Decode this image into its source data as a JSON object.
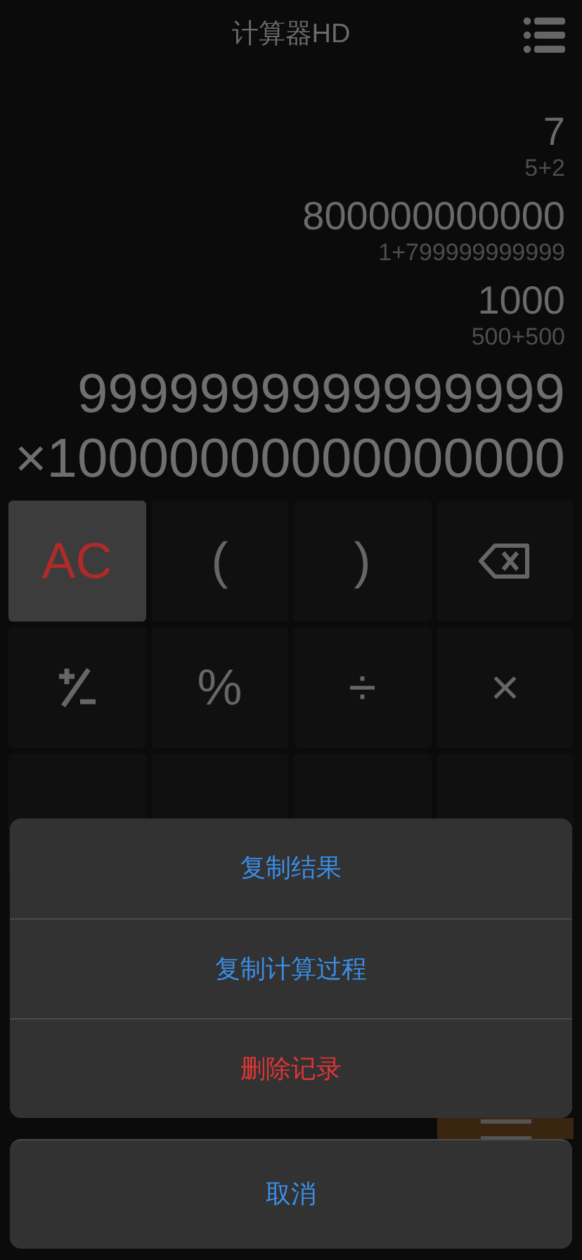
{
  "header": {
    "title": "计算器HD"
  },
  "history": [
    {
      "result": "7",
      "expression": "5+2"
    },
    {
      "result": "800000000000",
      "expression": "1+799999999999"
    },
    {
      "result": "1000",
      "expression": "500+500"
    }
  ],
  "current": {
    "lines": [
      "9999999999999999",
      "×10000000000000000"
    ]
  },
  "keys": [
    {
      "kind": "clear",
      "label": "AC"
    },
    {
      "kind": "text",
      "label": "("
    },
    {
      "kind": "text",
      "label": ")"
    },
    {
      "kind": "backspace"
    },
    {
      "kind": "sign"
    },
    {
      "kind": "text",
      "label": "%"
    },
    {
      "kind": "text",
      "label": "÷"
    },
    {
      "kind": "text",
      "label": "×"
    },
    {
      "kind": "blank"
    },
    {
      "kind": "blank"
    },
    {
      "kind": "blank"
    },
    {
      "kind": "blank"
    }
  ],
  "equals_key": {
    "kind": "equals"
  },
  "action_sheet": {
    "actions": [
      {
        "label": "复制结果",
        "kind": "normal"
      },
      {
        "label": "复制计算过程",
        "kind": "normal"
      },
      {
        "label": "删除记录",
        "kind": "destructive"
      }
    ],
    "cancel": "取消"
  }
}
